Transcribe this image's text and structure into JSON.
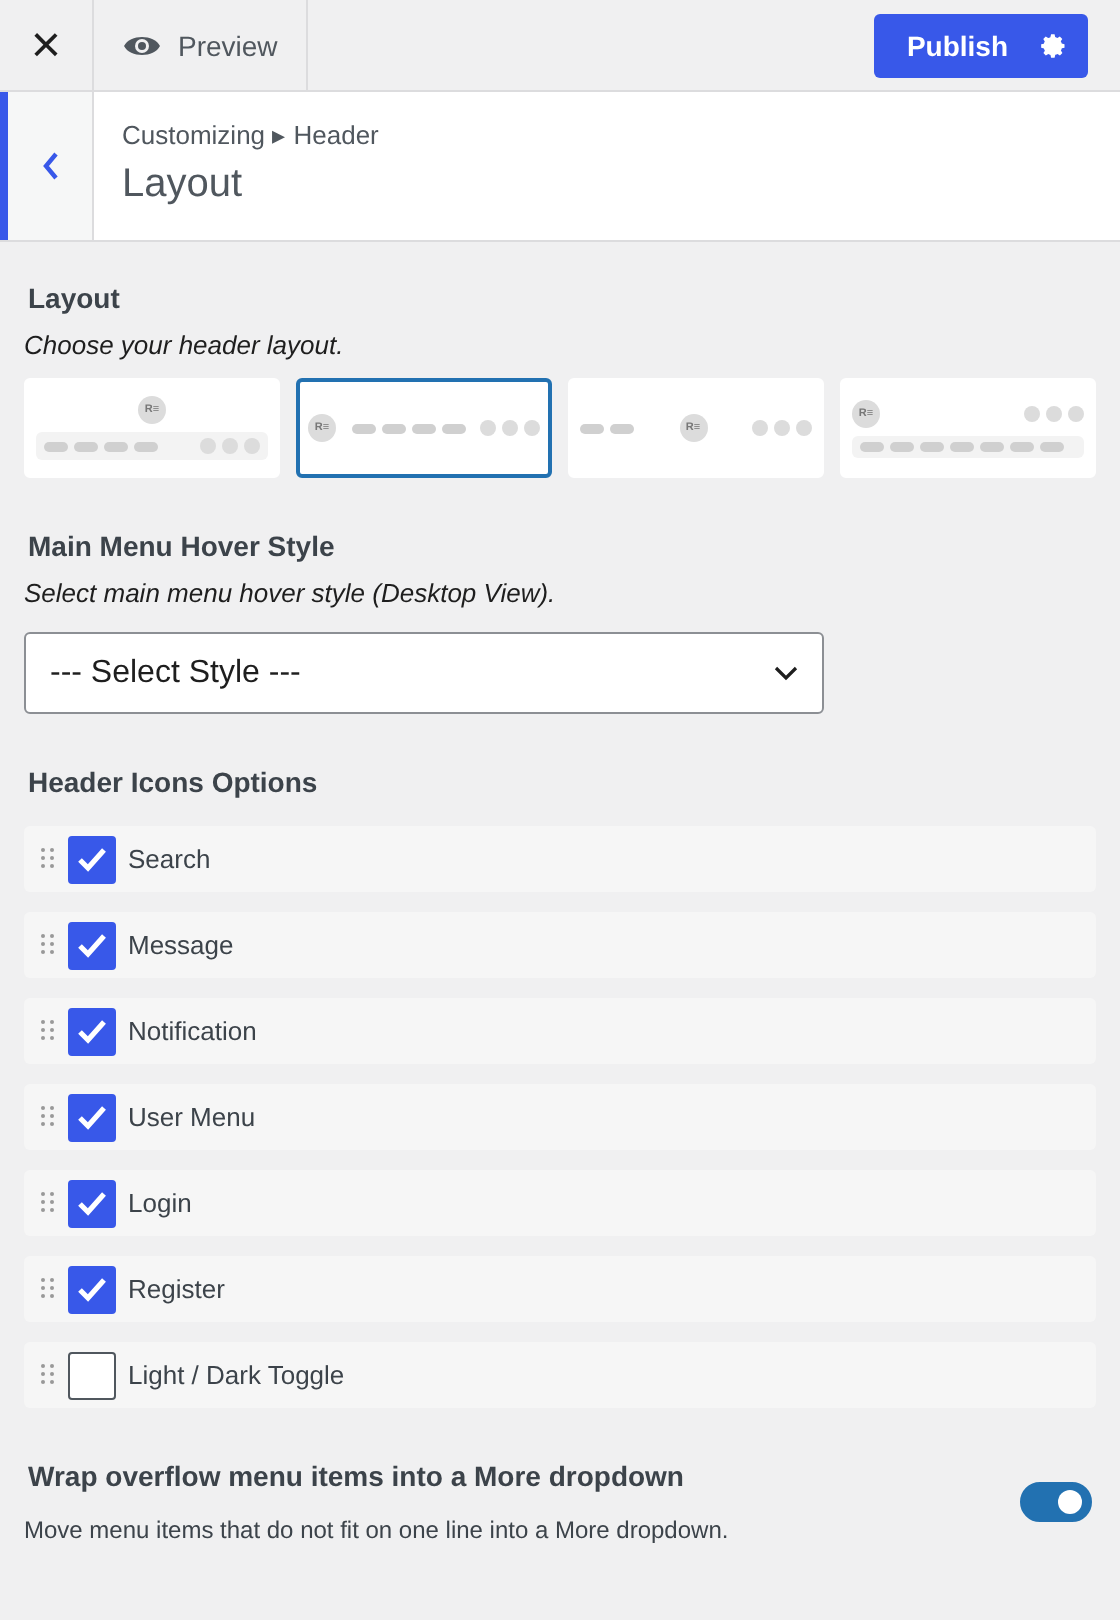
{
  "topbar": {
    "close": "×",
    "preview": "Preview",
    "publish": "Publish"
  },
  "header": {
    "breadcrumb": "Customizing ▸ Header",
    "title": "Layout"
  },
  "layout": {
    "heading": "Layout",
    "hint": "Choose your header layout.",
    "options": [
      {
        "kind": "stacked-centered",
        "logo": "R≡",
        "selected": false
      },
      {
        "kind": "inline",
        "logo": "R≡",
        "selected": true
      },
      {
        "kind": "center-logo",
        "logo": "R≡",
        "selected": false
      },
      {
        "kind": "stacked-left",
        "logo": "R≡",
        "selected": false
      }
    ]
  },
  "hover_style": {
    "heading": "Main Menu Hover Style",
    "hint": "Select main menu hover style (Desktop View).",
    "value": "--- Select Style ---"
  },
  "icons": {
    "heading": "Header Icons Options",
    "items": [
      {
        "label": "Search",
        "checked": true
      },
      {
        "label": "Message",
        "checked": true
      },
      {
        "label": "Notification",
        "checked": true
      },
      {
        "label": "User Menu",
        "checked": true
      },
      {
        "label": "Login",
        "checked": true
      },
      {
        "label": "Register",
        "checked": true
      },
      {
        "label": "Light / Dark Toggle",
        "checked": false
      }
    ]
  },
  "wrap": {
    "heading": "Wrap overflow menu items into a More dropdown",
    "hint": "Move menu items that do not fit on one line into a More dropdown.",
    "on": true
  }
}
